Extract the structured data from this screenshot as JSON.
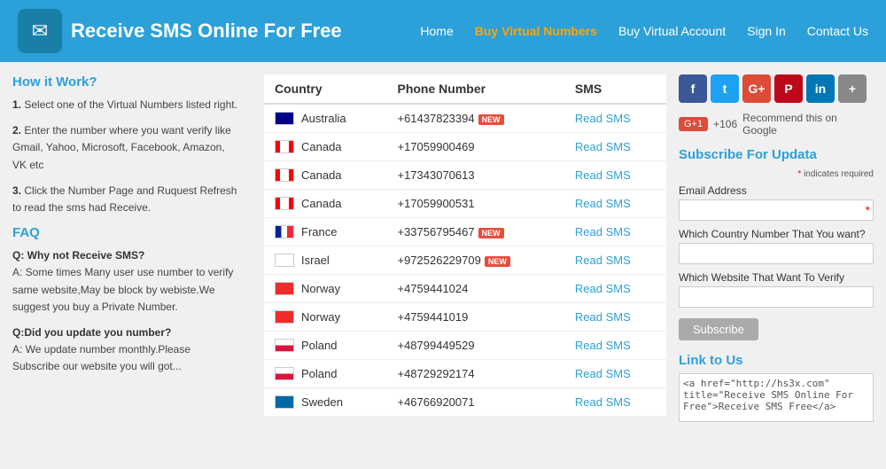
{
  "header": {
    "logo_icon": "✉",
    "site_title": "Receive SMS Online For Free",
    "nav": [
      {
        "label": "Home",
        "class": "normal"
      },
      {
        "label": "Buy Virtual Numbers",
        "class": "orange"
      },
      {
        "label": "Buy Virtual Account",
        "class": "normal"
      },
      {
        "label": "Sign In",
        "class": "normal"
      },
      {
        "label": "Contact Us",
        "class": "normal"
      }
    ]
  },
  "sidebar": {
    "how_title": "How it Work?",
    "how_steps": [
      "1. Select one of the Virtual Numbers listed right.",
      "2. Enter the number where you want verify like Gmail, Yahoo, Microsoft, Facebook, Amazon, VK etc",
      "3. Click the Number Page and Ruquest Refresh to read the sms had Receive."
    ],
    "faq_title": "FAQ",
    "faq_items": [
      {
        "question": "Q: Why not Receive SMS?",
        "answer": "A: Some times Many user use number to verify same website,May be block by webiste.We suggest you buy a Private Number."
      },
      {
        "question": "Q:Did you update you number?",
        "answer": "A: We update number monthly.Please Subscribe our website you will got..."
      }
    ]
  },
  "table": {
    "headers": [
      "Country",
      "Phone Number",
      "SMS"
    ],
    "rows": [
      {
        "flag": "au",
        "country": "Australia",
        "phone": "+61437823394",
        "new": true,
        "sms": "Read SMS"
      },
      {
        "flag": "ca",
        "country": "Canada",
        "phone": "+17059900469",
        "new": false,
        "sms": "Read SMS"
      },
      {
        "flag": "ca",
        "country": "Canada",
        "phone": "+17343070613",
        "new": false,
        "sms": "Read SMS"
      },
      {
        "flag": "ca",
        "country": "Canada",
        "phone": "+17059900531",
        "new": false,
        "sms": "Read SMS"
      },
      {
        "flag": "fr",
        "country": "France",
        "phone": "+33756795467",
        "new": true,
        "sms": "Read SMS"
      },
      {
        "flag": "il",
        "country": "Israel",
        "phone": "+972526229709",
        "new": true,
        "sms": "Read SMS"
      },
      {
        "flag": "no",
        "country": "Norway",
        "phone": "+4759441024",
        "new": false,
        "sms": "Read SMS"
      },
      {
        "flag": "no",
        "country": "Norway",
        "phone": "+4759441019",
        "new": false,
        "sms": "Read SMS"
      },
      {
        "flag": "pl",
        "country": "Poland",
        "phone": "+48799449529",
        "new": false,
        "sms": "Read SMS"
      },
      {
        "flag": "pl",
        "country": "Poland",
        "phone": "+48729292174",
        "new": false,
        "sms": "Read SMS"
      },
      {
        "flag": "se",
        "country": "Sweden",
        "phone": "+46766920071",
        "new": false,
        "sms": "Read SMS"
      }
    ]
  },
  "right_sidebar": {
    "social_buttons": [
      {
        "label": "f",
        "class": "social-fb",
        "name": "facebook"
      },
      {
        "label": "t",
        "class": "social-tw",
        "name": "twitter"
      },
      {
        "label": "G+",
        "class": "social-gp",
        "name": "googleplus"
      },
      {
        "label": "P",
        "class": "social-pi",
        "name": "pinterest"
      },
      {
        "label": "in",
        "class": "social-li",
        "name": "linkedin"
      },
      {
        "label": "+",
        "class": "social-more",
        "name": "more"
      }
    ],
    "gplus_label": "G+1",
    "gplus_count": "+106",
    "gplus_text": "Recommend this on Google",
    "subscribe_title": "Subscribe For Updata",
    "required_note": "* indicates required",
    "email_label": "Email Address",
    "country_label": "Which Country Number That You want?",
    "website_label": "Which Website That Want To Verify",
    "subscribe_btn": "Subscribe",
    "link_title": "Link to Us",
    "link_code": "<a href=\"http://hs3x.com\" title=\"Receive SMS Online For Free\">Receive SMS Free</a>"
  }
}
